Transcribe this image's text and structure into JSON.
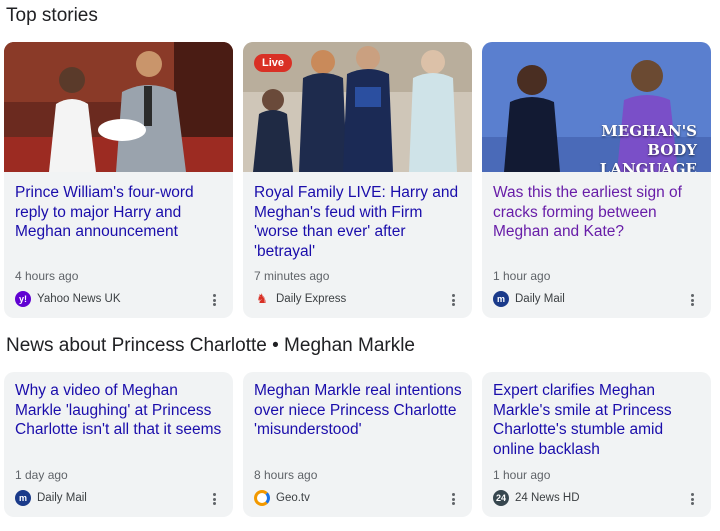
{
  "sections": {
    "top_stories_title": "Top stories",
    "news_about_title": "News about Princess Charlotte • Meghan Markle"
  },
  "top_stories": [
    {
      "headline": "Prince William's four-word reply to major Harry and Meghan announcement",
      "time": "4 hours ago",
      "source": "Yahoo News UK",
      "source_icon": "yahoo-logo-icon"
    },
    {
      "headline": "Royal Family LIVE: Harry and Meghan's feud with Firm 'worse than ever' after 'betrayal'",
      "time": "7 minutes ago",
      "source": "Daily Express",
      "source_icon": "daily-express-logo-icon",
      "badge": "Live"
    },
    {
      "headline": "Was this the earliest sign of cracks forming between Meghan and Kate?",
      "time": "1 hour ago",
      "source": "Daily Mail",
      "source_icon": "daily-mail-logo-icon",
      "image_text": "MEGHAN'S BODY LANGUAGE",
      "visited": true
    }
  ],
  "news_about": [
    {
      "headline": "Why a video of Meghan Markle 'laughing' at Princess Charlotte isn't all that it seems",
      "time": "1 day ago",
      "source": "Daily Mail",
      "source_icon": "daily-mail-logo-icon"
    },
    {
      "headline": "Meghan Markle real intentions over niece Princess Charlotte 'misunderstood'",
      "time": "8 hours ago",
      "source": "Geo.tv",
      "source_icon": "geo-tv-logo-icon"
    },
    {
      "headline": "Expert clarifies Meghan Markle's smile at Princess Charlotte's stumble amid online backlash",
      "time": "1 hour ago",
      "source": "24 News HD",
      "source_icon": "24-news-hd-logo-icon"
    }
  ],
  "colors": {
    "link": "#1a0dab",
    "visited_link": "#681da8",
    "card_bg": "#f1f3f4",
    "live_badge": "#d93025"
  }
}
